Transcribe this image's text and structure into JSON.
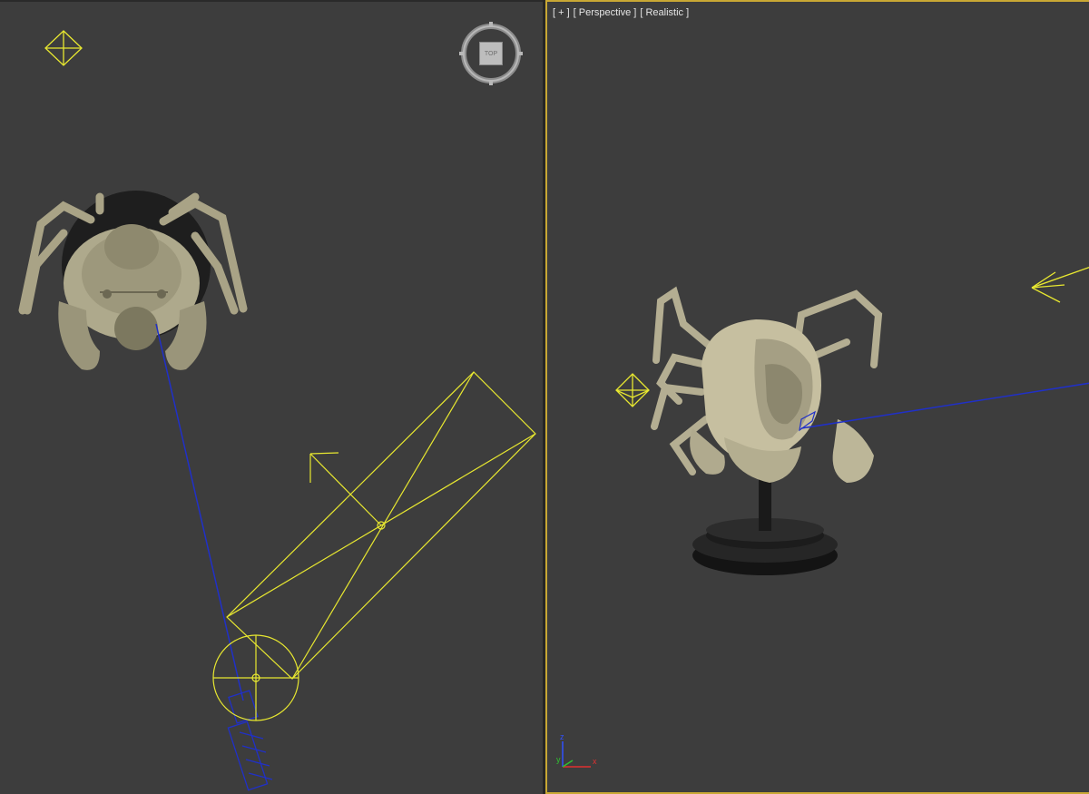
{
  "viewports": {
    "top": {
      "name": "Top",
      "viewcube": {
        "face_label": "TOP"
      }
    },
    "perspective": {
      "name": "Perspective",
      "label": {
        "plus": "[ + ]",
        "view": "[ Perspective ]",
        "shading": "[ Realistic ]"
      },
      "active": true,
      "axis_labels": {
        "x": "x",
        "y": "y",
        "z": "z"
      }
    }
  },
  "colors": {
    "viewport_bg": "#3d3d3d",
    "active_border": "#c9a834",
    "light_wire": "#ffff00",
    "camera_wire": "#2030c8",
    "model": "#bdb79a",
    "axis_x": "#e03030",
    "axis_y": "#30c030",
    "axis_z": "#3050ff"
  }
}
